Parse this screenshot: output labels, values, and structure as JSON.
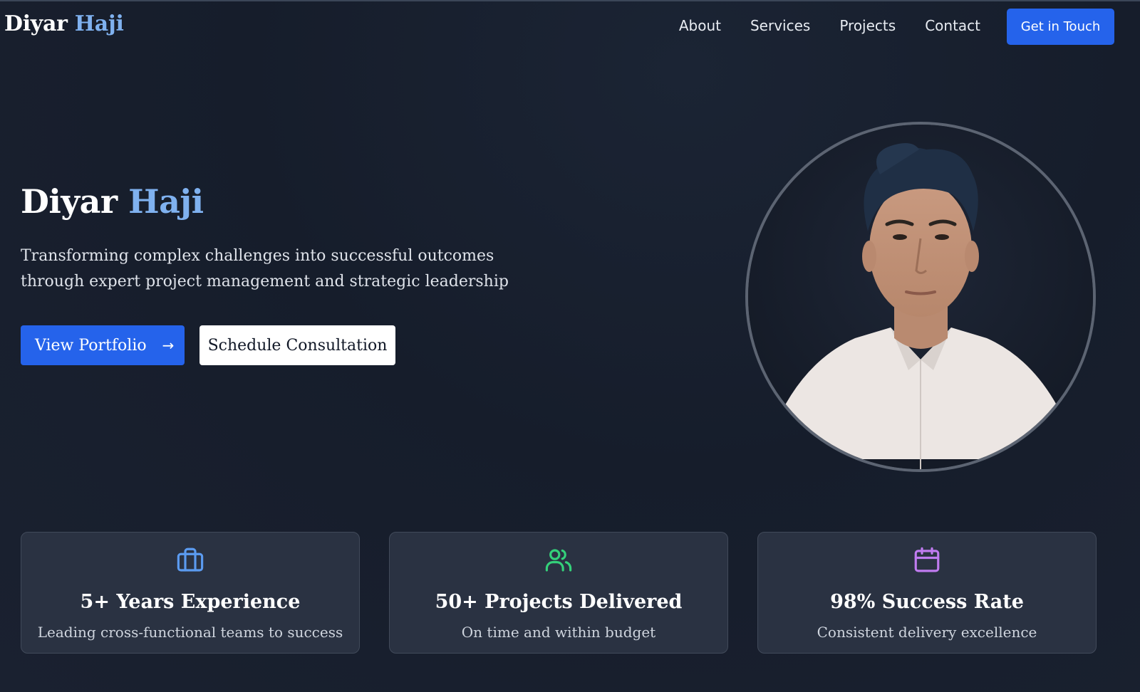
{
  "nav": {
    "brand_first": "Diyar",
    "brand_last": "Haji",
    "links": [
      "About",
      "Services",
      "Projects",
      "Contact"
    ],
    "cta": "Get in Touch"
  },
  "hero": {
    "title_first": "Diyar",
    "title_last": "Haji",
    "subtitle": "Transforming complex challenges into successful outcomes through expert project management and strategic leadership",
    "primary_button": "View Portfolio",
    "primary_button_icon": "arrow-right-icon",
    "secondary_button": "Schedule Consultation"
  },
  "stats": [
    {
      "icon": "briefcase-icon",
      "color": "#5b9bf0",
      "title": "5+ Years Experience",
      "desc": "Leading cross-functional teams to success"
    },
    {
      "icon": "users-icon",
      "color": "#34d17a",
      "title": "50+ Projects Delivered",
      "desc": "On time and within budget"
    },
    {
      "icon": "calendar-icon",
      "color": "#c07bf0",
      "title": "98% Success Rate",
      "desc": "Consistent delivery excellence"
    }
  ],
  "colors": {
    "accent": "#2563eb",
    "name_highlight": "#7fb1ef",
    "background": "#171e2b",
    "card": "#2a3242"
  }
}
